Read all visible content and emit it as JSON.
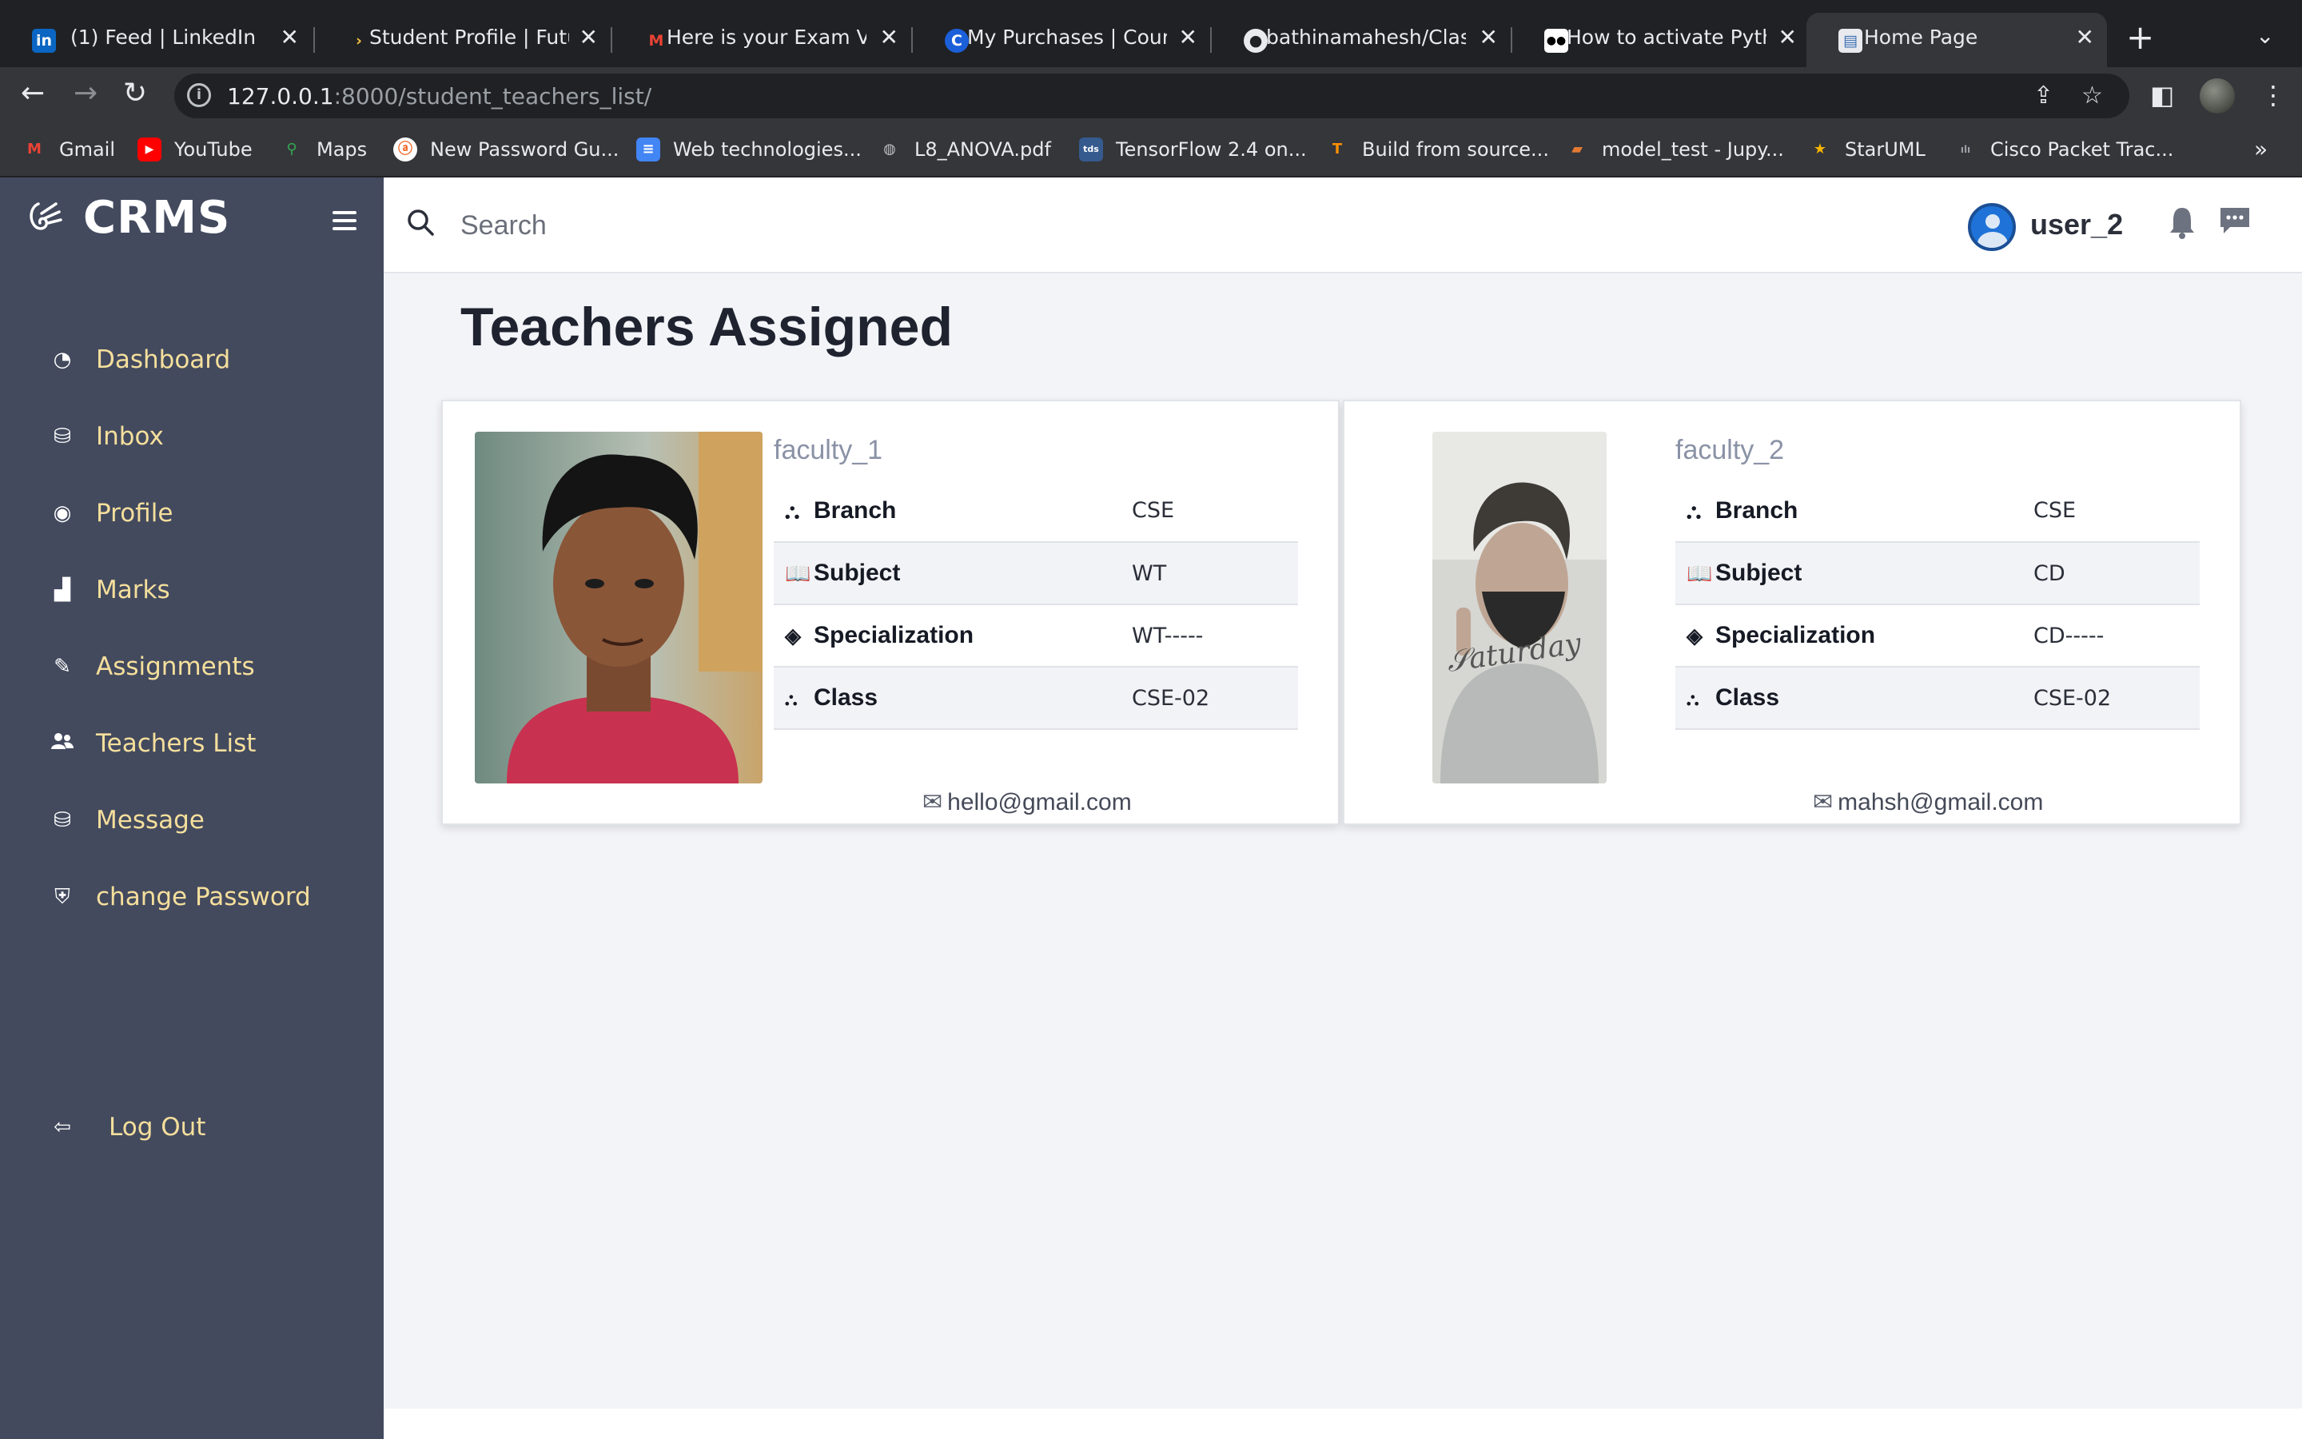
{
  "browser": {
    "tabs": [
      {
        "title": "(1) Feed | LinkedIn",
        "icon": "linkedin-icon",
        "color": "#0a66c2",
        "glyph": "in"
      },
      {
        "title": "Student Profile | Futur",
        "icon": "futurense-icon",
        "color": "#202124",
        "glyph": "›"
      },
      {
        "title": "Here is your Exam Vou",
        "icon": "gmail-icon",
        "color": "#202124",
        "glyph": "M"
      },
      {
        "title": "My Purchases | Cours",
        "icon": "coursera-icon",
        "color": "#1b5fd9",
        "glyph": "C"
      },
      {
        "title": "bathinamahesh/Classr",
        "icon": "github-icon",
        "color": "#202124",
        "glyph": "●"
      },
      {
        "title": "How to activate Pytho",
        "icon": "medium-icon",
        "color": "#000000",
        "glyph": "●●"
      },
      {
        "title": "Home Page",
        "icon": "page-icon",
        "color": "#3b6fb6",
        "glyph": "▤"
      }
    ],
    "url_host": "127.0.0.1",
    "url_path": ":8000/student_teachers_list/",
    "bookmarks": [
      {
        "label": "Gmail",
        "icon": "gmail-icon",
        "color": "#ea4335",
        "glyph": "M"
      },
      {
        "label": "YouTube",
        "icon": "youtube-icon",
        "color": "#ff0000",
        "glyph": "▶"
      },
      {
        "label": "Maps",
        "icon": "maps-icon",
        "color": "#34a853",
        "glyph": "⚲"
      },
      {
        "label": "New Password Gu...",
        "icon": "password-icon",
        "color": "#f26522",
        "glyph": "ⓐ"
      },
      {
        "label": "Web technologies...",
        "icon": "docs-icon",
        "color": "#4285f4",
        "glyph": "≡"
      },
      {
        "label": "L8_ANOVA.pdf",
        "icon": "globe-icon",
        "color": "#5f6368",
        "glyph": "◍"
      },
      {
        "label": "TensorFlow 2.4 on...",
        "icon": "tds-icon",
        "color": "#355a8e",
        "glyph": "tds"
      },
      {
        "label": "Build from source...",
        "icon": "tensorflow-icon",
        "color": "#ff8f00",
        "glyph": "T"
      },
      {
        "label": "model_test - Jupy...",
        "icon": "notebook-icon",
        "color": "#e37933",
        "glyph": "▰"
      },
      {
        "label": "StarUML",
        "icon": "staruml-icon",
        "color": "#f7b500",
        "glyph": "★"
      },
      {
        "label": "Cisco Packet Trac...",
        "icon": "cisco-icon",
        "color": "#444444",
        "glyph": "ılı"
      }
    ]
  },
  "app": {
    "brand": "CRMS",
    "nav": [
      {
        "label": "Dashboard",
        "icon": "dashboard-icon",
        "glyph": "◔"
      },
      {
        "label": "Inbox",
        "icon": "inbox-icon",
        "glyph": "⛁"
      },
      {
        "label": "Profile",
        "icon": "profile-icon",
        "glyph": "◉"
      },
      {
        "label": "Marks",
        "icon": "bar-chart-icon",
        "glyph": "▟"
      },
      {
        "label": "Assignments",
        "icon": "edit-icon",
        "glyph": "✎"
      },
      {
        "label": "Teachers List",
        "icon": "users-icon",
        "glyph": "👥"
      },
      {
        "label": "Message",
        "icon": "message-icon",
        "glyph": "⛁"
      },
      {
        "label": "change Password",
        "icon": "shield-icon",
        "glyph": "⛨"
      }
    ],
    "logout": {
      "label": "Log Out",
      "icon": "logout-icon",
      "glyph": "⇦"
    },
    "search_placeholder": "Search",
    "username": "user_2",
    "accent": "#f5df9c",
    "sidebar_bg": "#434a5e"
  },
  "main": {
    "title": "Teachers Assigned",
    "field_labels": {
      "branch": "Branch",
      "subject": "Subject",
      "specialization": "Specialization",
      "class": "Class"
    },
    "teachers": [
      {
        "name": "faculty_1",
        "branch": "CSE",
        "subject": "WT",
        "specialization": "WT-----",
        "class": "CSE-02",
        "email": "hello@gmail.com"
      },
      {
        "name": "faculty_2",
        "branch": "CSE",
        "subject": "CD",
        "specialization": "CD-----",
        "class": "CSE-02",
        "email": "mahsh@gmail.com"
      }
    ]
  }
}
